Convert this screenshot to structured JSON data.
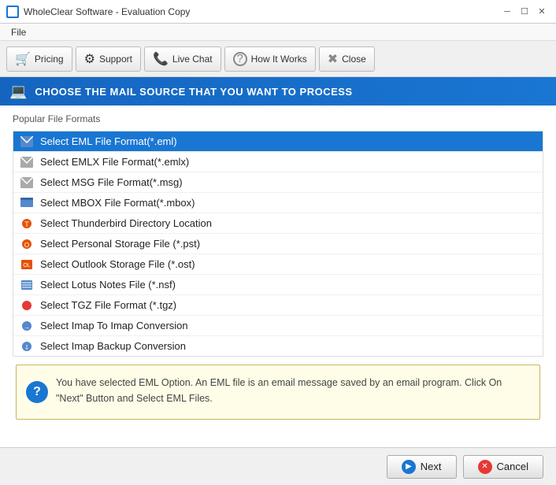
{
  "window": {
    "title": "WholeClear Software - Evaluation Copy",
    "menu": [
      "File"
    ]
  },
  "toolbar": {
    "buttons": [
      {
        "id": "pricing",
        "label": "Pricing",
        "icon": "🛒"
      },
      {
        "id": "support",
        "label": "Support",
        "icon": "⚙"
      },
      {
        "id": "live-chat",
        "label": "Live Chat",
        "icon": "📞"
      },
      {
        "id": "how-it-works",
        "label": "How It Works",
        "icon": "?"
      },
      {
        "id": "close",
        "label": "Close",
        "icon": "✖"
      }
    ]
  },
  "banner": {
    "text": "CHOOSE THE MAIL SOURCE THAT YOU WANT TO PROCESS"
  },
  "content": {
    "section_title": "Popular File Formats",
    "file_formats": [
      {
        "id": "eml",
        "label": "Select EML File Format(*.eml)",
        "icon": "📧",
        "selected": true
      },
      {
        "id": "emlx",
        "label": "Select EMLX File Format(*.emlx)",
        "icon": "📄",
        "selected": false
      },
      {
        "id": "msg",
        "label": "Select MSG File Format(*.msg)",
        "icon": "📄",
        "selected": false
      },
      {
        "id": "mbox",
        "label": "Select MBOX File Format(*.mbox)",
        "icon": "🗂",
        "selected": false
      },
      {
        "id": "thunderbird",
        "label": "Select Thunderbird Directory Location",
        "icon": "🦅",
        "selected": false
      },
      {
        "id": "pst",
        "label": "Select Personal Storage File (*.pst)",
        "icon": "📦",
        "selected": false
      },
      {
        "id": "ost",
        "label": "Select Outlook Storage File (*.ost)",
        "icon": "📦",
        "selected": false
      },
      {
        "id": "lotus",
        "label": "Select Lotus Notes File (*.nsf)",
        "icon": "🗄",
        "selected": false
      },
      {
        "id": "tgz",
        "label": "Select TGZ File Format (*.tgz)",
        "icon": "🔴",
        "selected": false
      },
      {
        "id": "imap-conv",
        "label": "Select Imap To Imap Conversion",
        "icon": "🔁",
        "selected": false
      },
      {
        "id": "imap-backup",
        "label": "Select Imap Backup Conversion",
        "icon": "🔁",
        "selected": false
      }
    ],
    "info_text": "You have selected EML Option. An EML file is an email message saved by an email program. Click On \"Next\" Button and Select EML Files."
  },
  "footer": {
    "next_label": "Next",
    "cancel_label": "Cancel"
  }
}
